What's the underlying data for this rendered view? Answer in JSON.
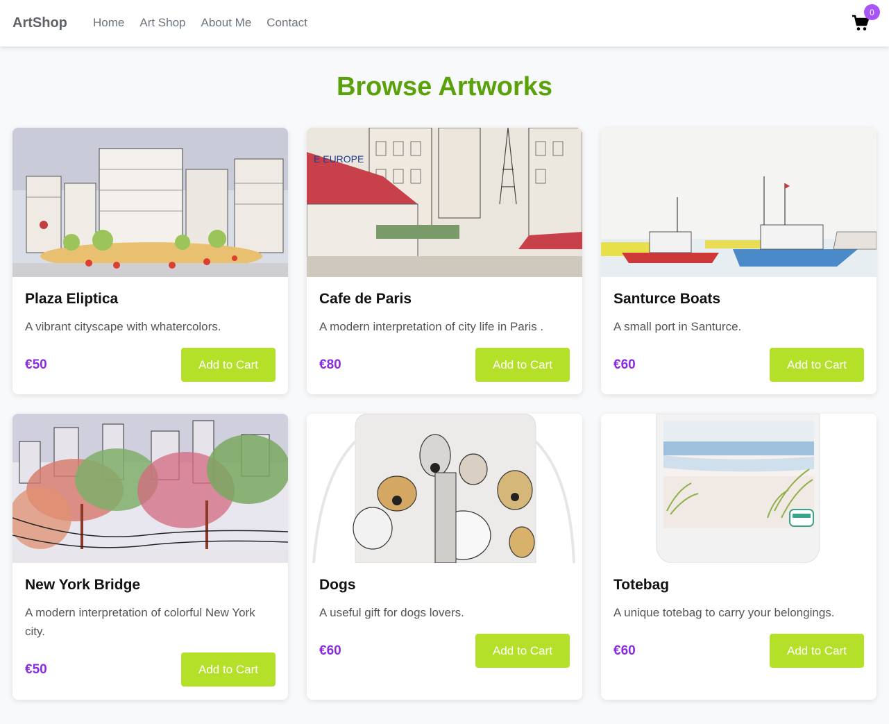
{
  "colors": {
    "accent_green": "#5aa10a",
    "button_green": "#b5e02a",
    "price_purple": "#8a2be2",
    "badge_purple": "#a855f7"
  },
  "navbar": {
    "brand": "ArtShop",
    "links": [
      "Home",
      "Art Shop",
      "About Me",
      "Contact"
    ],
    "cart_icon": "shopping-cart-icon",
    "cart_count": "0"
  },
  "page": {
    "title": "Browse Artworks"
  },
  "products": [
    {
      "title": "Plaza Eliptica",
      "description": "A vibrant cityscape with whatercolors.",
      "price": "€50",
      "button": "Add to Cart",
      "image": "watercolor-plaza-painting"
    },
    {
      "title": "Cafe de Paris",
      "description": "A modern interpretation of city life in Paris .",
      "price": "€80",
      "button": "Add to Cart",
      "image": "watercolor-paris-street-painting"
    },
    {
      "title": "Santurce Boats",
      "description": "A small port in Santurce.",
      "price": "€60",
      "button": "Add to Cart",
      "image": "watercolor-boats-painting"
    },
    {
      "title": "New York Bridge",
      "description": "A modern interpretation of colorful New York city.",
      "price": "€50",
      "button": "Add to Cart",
      "image": "watercolor-new-york-bridge-painting"
    },
    {
      "title": "Dogs",
      "description": "A useful gift for dogs lovers.",
      "price": "€60",
      "button": "Add to Cart",
      "image": "dogs-apron-product"
    },
    {
      "title": "Totebag",
      "description": "A unique totebag to carry your belongings.",
      "price": "€60",
      "button": "Add to Cart",
      "image": "beach-totebag-product"
    }
  ]
}
